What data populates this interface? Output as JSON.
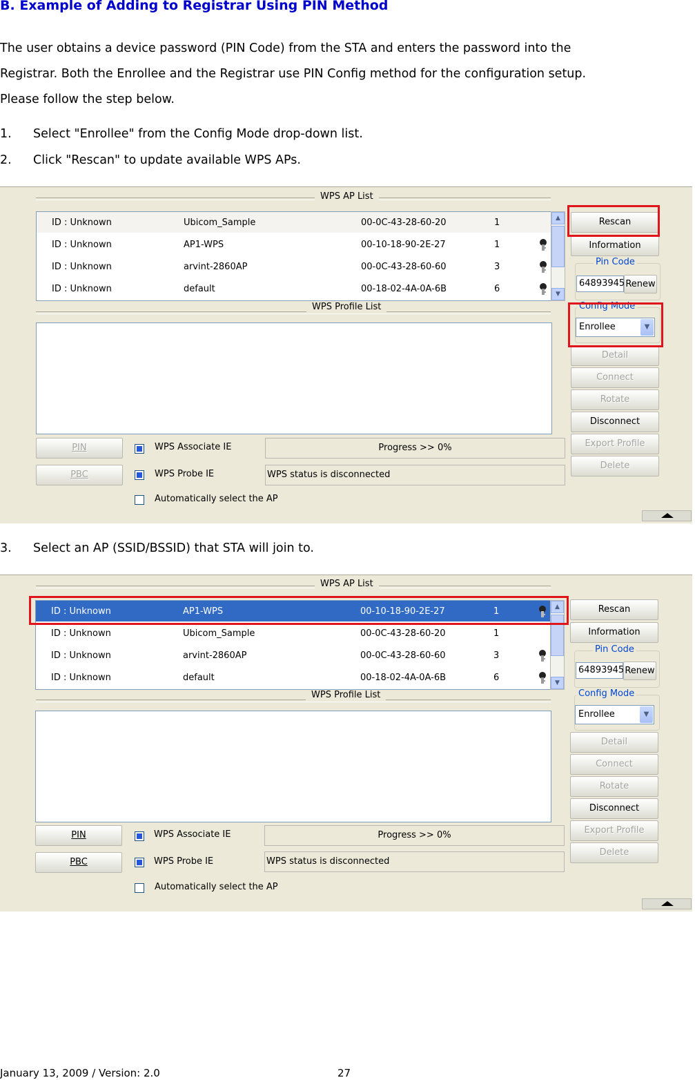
{
  "heading": "B.  Example of Adding to Registrar Using PIN Method",
  "intro": {
    "line1": "The user obtains a device password (PIN Code) from the STA and enters the password into the",
    "line2": "Registrar. Both the Enrollee and the Registrar use PIN Config method for the configuration setup.",
    "line3": "Please follow the step below."
  },
  "steps": [
    {
      "num": "1.",
      "text": "Select \"Enrollee\" from the Config Mode drop-down list."
    },
    {
      "num": "2.",
      "text": "Click \"Rescan\" to update available WPS APs."
    },
    {
      "num": "3.",
      "text": "Select an AP (SSID/BSSID) that STA will join to."
    }
  ],
  "panel1": {
    "ap_list_title": "WPS AP List",
    "profile_list_title": "WPS Profile List",
    "rows": [
      {
        "id": "ID : Unknown",
        "ssid": "Ubicom_Sample",
        "bssid": "00-0C-43-28-60-20",
        "channel": "1",
        "lock": false
      },
      {
        "id": "ID : Unknown",
        "ssid": "AP1-WPS",
        "bssid": "00-10-18-90-2E-27",
        "channel": "1",
        "lock": true
      },
      {
        "id": "ID : Unknown",
        "ssid": "arvint-2860AP",
        "bssid": "00-0C-43-28-60-60",
        "channel": "3",
        "lock": true
      },
      {
        "id": "ID : Unknown",
        "ssid": "default",
        "bssid": "00-18-02-4A-0A-6B",
        "channel": "6",
        "lock": true
      }
    ],
    "buttons": {
      "rescan": "Rescan",
      "information": "Information",
      "renew": "Renew",
      "detail": "Detail",
      "connect": "Connect",
      "rotate": "Rotate",
      "disconnect": "Disconnect",
      "export_profile": "Export Profile",
      "delete": "Delete",
      "pin": "PIN",
      "pbc": "PBC"
    },
    "pin_code_label": "Pin Code",
    "pin_code_value": "64893945",
    "config_mode_label": "Config Mode",
    "config_mode_value": "Enrollee",
    "wps_associate_ie": "WPS Associate IE",
    "wps_probe_ie": "WPS Probe IE",
    "auto_select": "Automatically select the AP",
    "progress": "Progress >> 0%",
    "status": "WPS status is disconnected"
  },
  "panel2": {
    "ap_list_title": "WPS AP List",
    "profile_list_title": "WPS Profile List",
    "rows": [
      {
        "id": "ID : Unknown",
        "ssid": "AP1-WPS",
        "bssid": "00-10-18-90-2E-27",
        "channel": "1",
        "lock": true
      },
      {
        "id": "ID : Unknown",
        "ssid": "Ubicom_Sample",
        "bssid": "00-0C-43-28-60-20",
        "channel": "1",
        "lock": false
      },
      {
        "id": "ID : Unknown",
        "ssid": "arvint-2860AP",
        "bssid": "00-0C-43-28-60-60",
        "channel": "3",
        "lock": true
      },
      {
        "id": "ID : Unknown",
        "ssid": "default",
        "bssid": "00-18-02-4A-0A-6B",
        "channel": "6",
        "lock": true
      }
    ],
    "buttons": {
      "rescan": "Rescan",
      "information": "Information",
      "renew": "Renew",
      "detail": "Detail",
      "connect": "Connect",
      "rotate": "Rotate",
      "disconnect": "Disconnect",
      "export_profile": "Export Profile",
      "delete": "Delete",
      "pin": "PIN",
      "pbc": "PBC"
    },
    "pin_code_label": "Pin Code",
    "pin_code_value": "64893945",
    "config_mode_label": "Config Mode",
    "config_mode_value": "Enrollee",
    "wps_associate_ie": "WPS Associate IE",
    "wps_probe_ie": "WPS Probe IE",
    "auto_select": "Automatically select the AP",
    "progress": "Progress >> 0%",
    "status": "WPS status is disconnected"
  },
  "footer": {
    "date_version": "January 13, 2009 / Version: 2.0",
    "page": "27"
  },
  "colors": {
    "heading": "#0000cc",
    "selected_row": "#316ac5",
    "highlight_box": "#e0141b",
    "groupbox_title": "#0046d5"
  }
}
